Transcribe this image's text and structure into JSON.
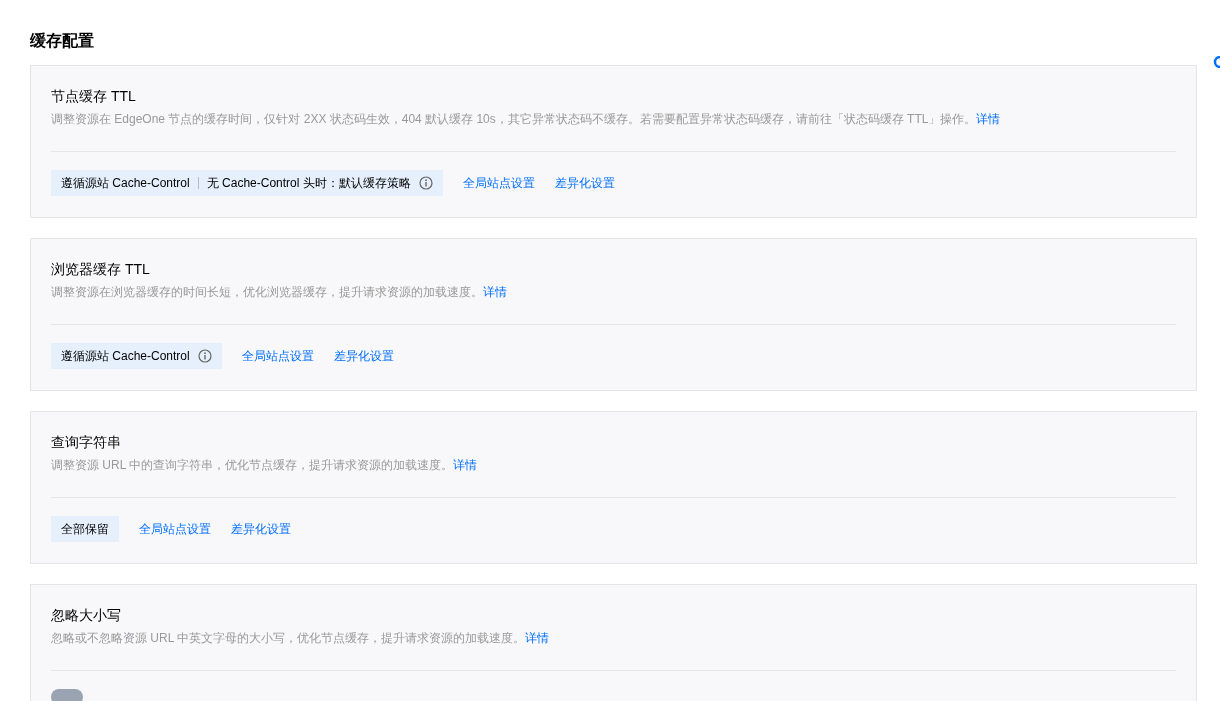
{
  "page_title": "缓存配置",
  "sections": [
    {
      "kind": "tag",
      "title": "节点缓存 TTL",
      "description": "调整资源在 EdgeOne 节点的缓存时间，仅针对 2XX 状态码生效，404 默认缓存 10s，其它异常状态码不缓存。若需要配置异常状态码缓存，请前往「状态码缓存 TTL」操作。",
      "detail_link": "详情",
      "tag_parts": [
        "遵循源站 Cache-Control",
        "无 Cache-Control 头时：默认缓存策略"
      ],
      "info": true,
      "actions": [
        "全局站点设置",
        "差异化设置"
      ]
    },
    {
      "kind": "tag",
      "title": "浏览器缓存 TTL",
      "description": "调整资源在浏览器缓存的时间长短，优化浏览器缓存，提升请求资源的加载速度。",
      "detail_link": "详情",
      "tag_parts": [
        "遵循源站 Cache-Control"
      ],
      "info": true,
      "actions": [
        "全局站点设置",
        "差异化设置"
      ]
    },
    {
      "kind": "tag",
      "title": "查询字符串",
      "description": "调整资源 URL 中的查询字符串，优化节点缓存，提升请求资源的加载速度。",
      "detail_link": "详情",
      "tag_parts": [
        "全部保留"
      ],
      "info": false,
      "actions": [
        "全局站点设置",
        "差异化设置"
      ]
    },
    {
      "kind": "switch",
      "title": "忽略大小写",
      "description": "忽略或不忽略资源 URL 中英文字母的大小写，优化节点缓存，提升请求资源的加载速度。",
      "detail_link": "详情",
      "on": false
    }
  ]
}
